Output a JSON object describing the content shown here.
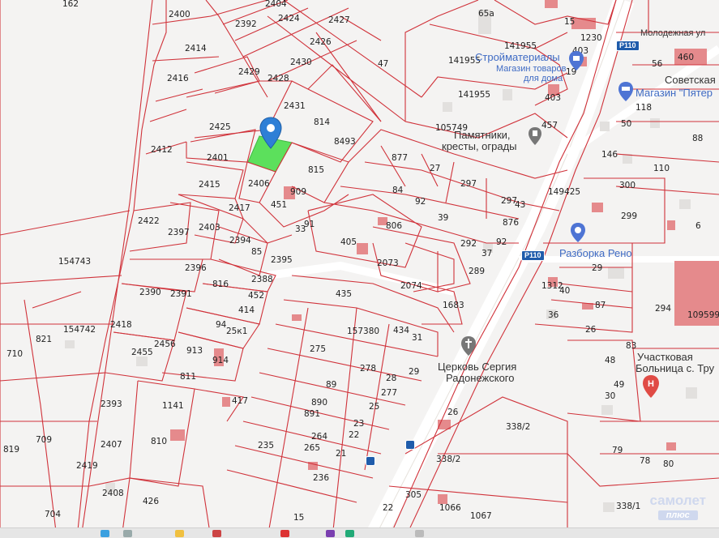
{
  "parcels": [
    "162",
    "2400",
    "2414",
    "2392",
    "2404",
    "2424",
    "2427",
    "2426",
    "2430",
    "47",
    "65а",
    "15",
    "1230",
    "460",
    "56",
    "2416",
    "2429",
    "2428",
    "2425",
    "2431",
    "814",
    "8493",
    "141955",
    "141955",
    "141955",
    "403",
    "19",
    "403",
    "457",
    "118",
    "50",
    "88",
    "2412",
    "2401",
    "2415",
    "2406",
    "815",
    "909",
    "451",
    "877",
    "27",
    "84",
    "92",
    "297",
    "105749",
    "297",
    "43",
    "146",
    "110",
    "300",
    "2417",
    "33",
    "91",
    "806",
    "39",
    "876",
    "149425",
    "299",
    "6",
    "2422",
    "2397",
    "2403",
    "2394",
    "85",
    "2395",
    "405",
    "292",
    "37",
    "92",
    "154743",
    "2396",
    "2388",
    "2073",
    "2074",
    "289",
    "29",
    "1312",
    "40",
    "2390",
    "2391",
    "816",
    "452",
    "414",
    "435",
    "1683",
    "87",
    "36",
    "294",
    "109599",
    "2418",
    "94",
    "25к1",
    "157380",
    "434",
    "31",
    "26",
    "83",
    "821",
    "710",
    "154742",
    "2455",
    "2456",
    "913",
    "914",
    "275",
    "278",
    "28",
    "29",
    "48",
    "811",
    "1141",
    "417",
    "89",
    "277",
    "890",
    "25",
    "49",
    "30",
    "2393",
    "891",
    "23",
    "264",
    "22",
    "2407",
    "810",
    "235",
    "265",
    "21",
    "26",
    "338/2",
    "79",
    "78",
    "80",
    "709",
    "2419",
    "2408",
    "236",
    "305",
    "1066",
    "1067",
    "338/2",
    "338/1",
    "819",
    "426",
    "704",
    "15",
    "22"
  ],
  "pois": {
    "stroymaterialy": "Стройматериалы",
    "magazin_tovarov_1": "Магазин товаров",
    "magazin_tovarov_2": "для дома",
    "pyaterochka": "Магазин \"Пятер",
    "sovetskaya": "Советская",
    "pamyatniki_1": "Памятники,",
    "pamyatniki_2": "кресты, ограды",
    "razborka": "Разборка Рено",
    "cerkov_1": "Церковь Сергия",
    "cerkov_2": "Радонежского",
    "bolnica_1": "Участковая",
    "bolnica_2": "Больница с. Тру",
    "molodezhnaya": "Молодежная ул"
  },
  "roads": {
    "p110_a": "P110",
    "p110_b": "P110"
  },
  "watermark": {
    "line1": "самолет",
    "line2": "плюс"
  },
  "colors": {
    "parcel_line": "#d0323a",
    "highlight": "#5ce05c",
    "pin": "#2e7fd6",
    "building": "#e07e80",
    "road": "#ffffff"
  },
  "icons": [
    "location-pin-icon",
    "shop-icon",
    "cart-icon",
    "monument-icon",
    "car-parts-icon",
    "church-icon",
    "hospital-icon",
    "bus-stop-icon"
  ]
}
